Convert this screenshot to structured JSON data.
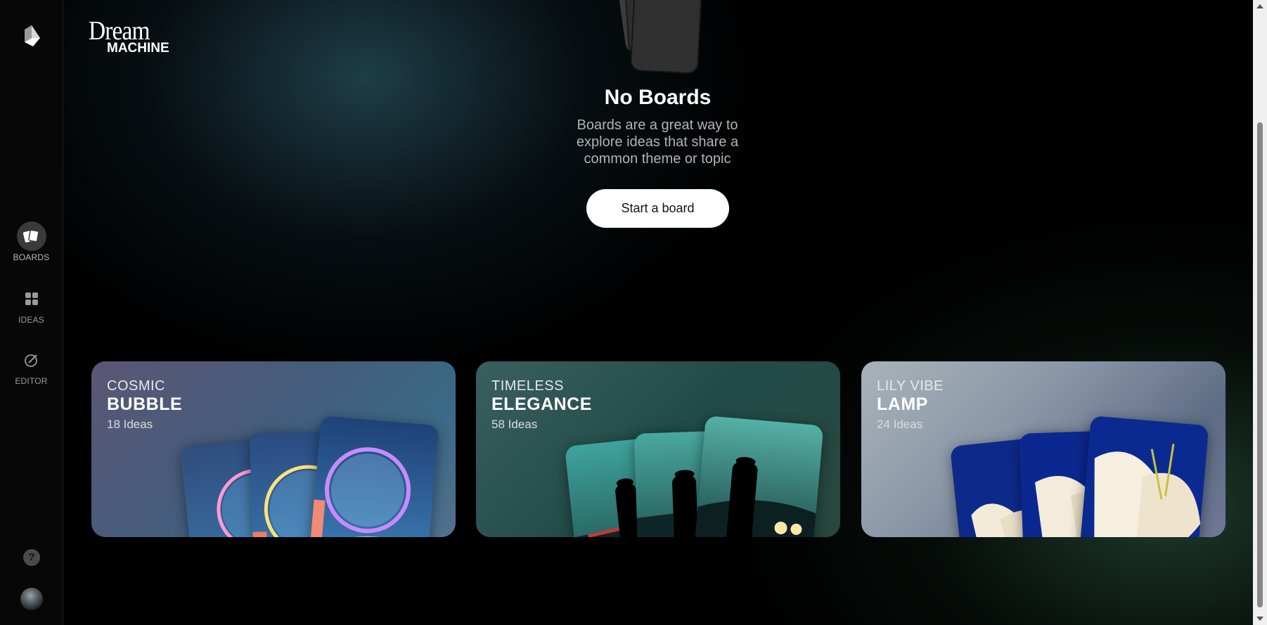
{
  "brand": {
    "line1": "Dream",
    "line2": "MACHINE"
  },
  "sidebar": {
    "items": [
      {
        "label": "BOARDS",
        "icon": "boards-icon",
        "active": true
      },
      {
        "label": "IDEAS",
        "icon": "grid-icon",
        "active": false
      },
      {
        "label": "EDITOR",
        "icon": "editor-icon",
        "active": false
      }
    ],
    "help_label": "?"
  },
  "empty_state": {
    "title": "No Boards",
    "description": "Boards are a great way to explore ideas that share a common theme or topic",
    "button_label": "Start a board"
  },
  "cards": [
    {
      "line1": "COSMIC",
      "line2": "BUBBLE",
      "count": "18 Ideas",
      "theme": "bubble"
    },
    {
      "line1": "TIMELESS",
      "line2": "ELEGANCE",
      "count": "58 Ideas",
      "theme": "noir"
    },
    {
      "line1": "LILY VIBE",
      "line2": "LAMP",
      "count": "24 Ideas",
      "theme": "lily"
    }
  ],
  "colors": {
    "background": "#000000",
    "sidebar": "#070707",
    "button_bg": "#ffffff",
    "accent_teal": "#1e3a45",
    "accent_green": "#284e3a"
  }
}
